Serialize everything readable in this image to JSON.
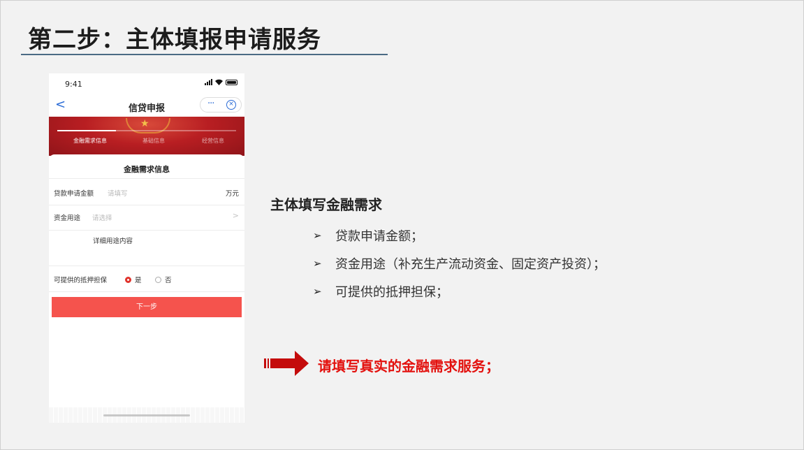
{
  "slide": {
    "title": "第二步：主体填报申请服务"
  },
  "phone": {
    "status_time": "9:41",
    "nav_title": "信贷申报",
    "back_glyph": "<",
    "more_glyph": "···",
    "close_glyph": "×",
    "progress_fraction": 0.33,
    "steps": [
      "金融需求信息",
      "基础信息",
      "经营信息"
    ],
    "section_title": "金融需求信息",
    "form": {
      "loan_amount": {
        "label": "贷款申请金额",
        "placeholder": "请填写",
        "unit": "万元"
      },
      "fund_use": {
        "label": "资金用途",
        "placeholder": "请选择",
        "chevron": ">"
      },
      "detail_label": "详细用途内容",
      "collateral": {
        "label": "可提供的抵押担保",
        "options": [
          "是",
          "否"
        ],
        "selected": "是"
      }
    },
    "submit_label": "下一步"
  },
  "content": {
    "heading": "主体填写金融需求",
    "bullet_marker": "➢",
    "bullets": [
      "贷款申请金额；",
      "资金用途（补充生产流动资金、固定资产投资）；",
      "可提供的抵押担保；"
    ],
    "callout": "请填写真实的金融需求服务；"
  },
  "colors": {
    "accent_red": "#e3110e",
    "button_red": "#f5534d",
    "banner_red": "#b81e22",
    "link_blue": "#2a6bd6",
    "title_rule": "#4b6b84"
  }
}
